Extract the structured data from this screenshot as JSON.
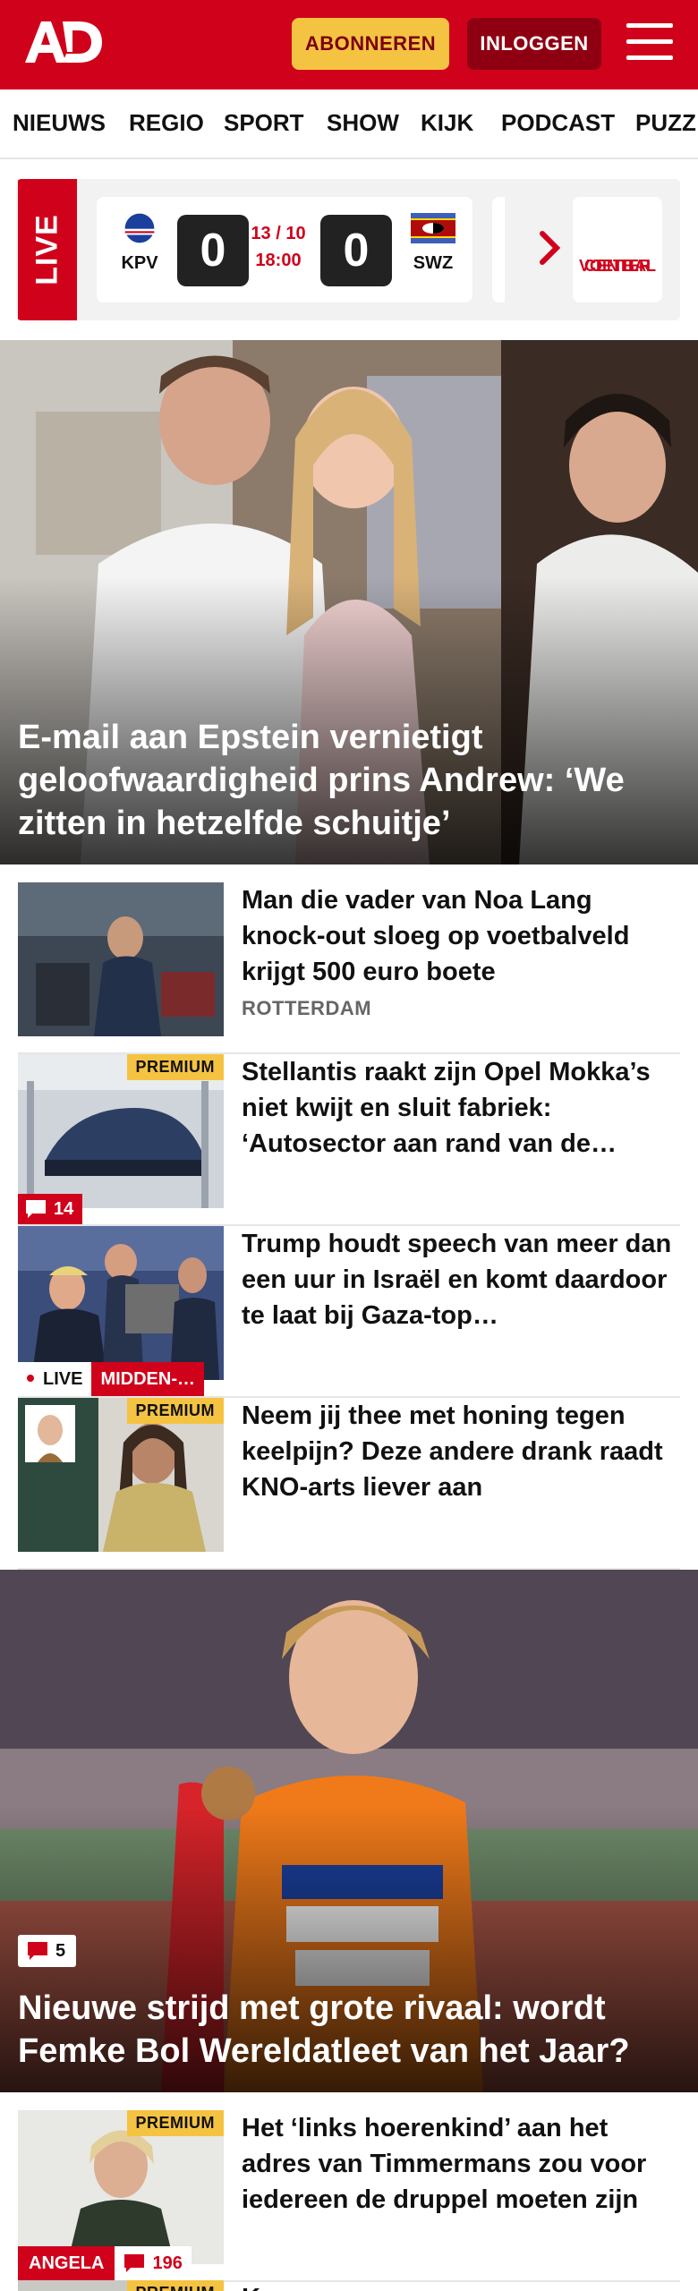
{
  "header": {
    "logo": "AD",
    "subscribe_label": "ABONNEREN",
    "login_label": "INLOGGEN"
  },
  "nav": {
    "items": [
      "NIEUWS",
      "REGIO",
      "SPORT",
      "SHOW",
      "KIJK",
      "PODCAST",
      "PUZZ"
    ]
  },
  "live": {
    "badge": "LIVE",
    "match": {
      "home_code": "KPV",
      "away_code": "SWZ",
      "home_score": "0",
      "away_score": "0",
      "date": "13 / 10",
      "time": "18:00"
    },
    "center_line1": "VOETBAL",
    "center_line2": "CENTER"
  },
  "hero1": {
    "headline": "E-mail aan Epstein vernietigt geloofwaardigheid prins Andrew: ‘We zitten in hetzelfde schuitje’"
  },
  "articles": [
    {
      "title": "Man die vader van Noa Lang knock-out sloeg op voetbalveld krijgt 500 euro boete",
      "meta": "ROTTERDAM"
    },
    {
      "title": "Stellantis raakt zijn Opel Mokka’s niet kwijt en sluit fabriek: ‘Autosector aan rand van de…",
      "premium": "PREMIUM",
      "comments": "14"
    },
    {
      "title": "Trump houdt speech van meer dan een uur in Israël en komt daardoor te laat bij Gaza-top…",
      "live": "LIVE",
      "category": "MIDDEN-…"
    },
    {
      "title": "Neem jij thee met honing tegen keelpijn? Deze andere drank raadt KNO-arts liever aan",
      "premium": "PREMIUM"
    }
  ],
  "hero2": {
    "headline": "Nieuwe strijd met grote rivaal: wordt Femke Bol Wereldatleet van het Jaar?",
    "comments": "5"
  },
  "articles2": [
    {
      "title": "Het ‘links hoerenkind’ aan het adres van Timmermans zou voor iedereen de druppel moeten zijn",
      "premium": "PREMIUM",
      "author": "ANGELA",
      "comments": "196"
    },
    {
      "title": "Kassa",
      "premium": "PREMIUM"
    }
  ],
  "colors": {
    "brand_red": "#d0021b",
    "premium_yellow": "#f5c342",
    "login_dark_red": "#8e0011"
  },
  "icons": [
    "hamburger-menu-icon",
    "chevron-right-icon",
    "comment-icon",
    "flag-kpv-icon",
    "flag-swz-icon"
  ]
}
